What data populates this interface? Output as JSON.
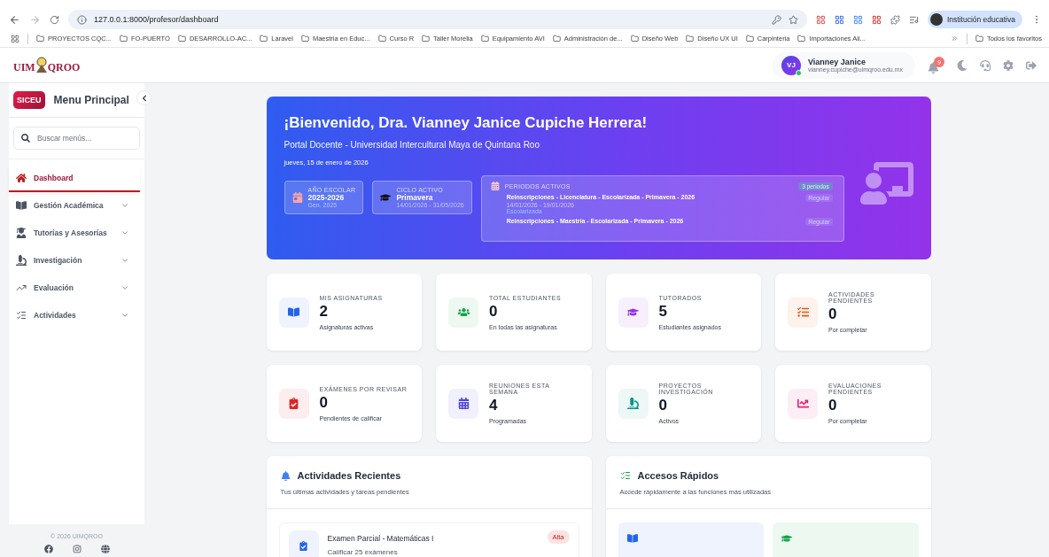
{
  "browser": {
    "url": "127.0.0.1:8000/profesor/dashboard",
    "profile": "Institución educativa",
    "bookmarks": [
      "PROYECTOS CQC...",
      "FO-PUERTO",
      "DESARROLLO-AC...",
      "Laravel",
      "Maestria en Educ...",
      "Curso R",
      "Taller Morelia",
      "Equipamiento AVI",
      "Administración de...",
      "Diseño Web",
      "Diseño UX UI",
      "Carpinteria",
      "Importaciones Ali..."
    ],
    "all_bookmarks": "Todos los favoritos"
  },
  "header": {
    "logo_left": "UIM",
    "logo_right": "QROO",
    "user": {
      "initials": "VJ",
      "name": "Vianney Janice",
      "email": "vianney.cupiche@uimqroo.edu.mx",
      "online": true
    },
    "notifications": "9"
  },
  "sidebar": {
    "badge": "SICEU",
    "title": "Menu Principal",
    "search": {
      "placeholder": "Buscar menús..."
    },
    "items": [
      {
        "label": "Dashboard",
        "selected": true,
        "expandable": false
      },
      {
        "label": "Gestión Académica",
        "selected": false,
        "expandable": true
      },
      {
        "label": "Tutorías y Asesorías",
        "selected": false,
        "expandable": true
      },
      {
        "label": "Investigación",
        "selected": false,
        "expandable": true
      },
      {
        "label": "Evaluación",
        "selected": false,
        "expandable": true
      },
      {
        "label": "Actividades",
        "selected": false,
        "expandable": true
      }
    ],
    "copyright": "© 2026 UIMQROO"
  },
  "hero": {
    "title": "¡Bienvenido, Dra. Vianney Janice Cupiche Herrera!",
    "subtitle": "Portal Docente - Universidad Intercultural Maya de Quintana Roo",
    "date": "jueves, 15 de enero de 2026",
    "info": [
      {
        "label": "AÑO ESCOLAR",
        "value": "2025-2026",
        "sub": "Gen. 2025"
      },
      {
        "label": "CICLO ACTIVO",
        "value": "Primavera",
        "sub": "14/01/2026 - 31/05/2026"
      }
    ],
    "periods": {
      "title": "PERIODOS ACTIVOS",
      "count": "3 periodos",
      "items": [
        {
          "name": "Reinscripciones - Licenciatura - Escolarizada - Primavera - 2026",
          "dates": "14/01/2026 - 19/01/2026",
          "mode": "Escolarizada",
          "type": "Regular"
        },
        {
          "name": "Reinscripciones - Maestría - Escolarizada - Primavera - 2026",
          "type": "Regular"
        }
      ]
    }
  },
  "stats": [
    {
      "label": "MIS ASIGNATURAS",
      "value": "2",
      "caption": "Asignaturas activas",
      "color": "#2563eb"
    },
    {
      "label": "TOTAL ESTUDIANTES",
      "value": "0",
      "caption": "En todas las asignaturas",
      "color": "#16a34a"
    },
    {
      "label": "TUTORADOS",
      "value": "5",
      "caption": "Estudiantes asignados",
      "color": "#9333ea"
    },
    {
      "label": "ACTIVIDADES PENDIENTES",
      "value": "0",
      "caption": "Por completar",
      "color": "#ea580c"
    },
    {
      "label": "EXÁMENES POR REVISAR",
      "value": "0",
      "caption": "Pendientes de calificar",
      "color": "#dc2626"
    },
    {
      "label": "REUNIONES ESTA SEMANA",
      "value": "4",
      "caption": "Programadas",
      "color": "#4f46e5"
    },
    {
      "label": "PROYECTOS INVESTIGACIÓN",
      "value": "0",
      "caption": "Activos",
      "color": "#0d9488"
    },
    {
      "label": "EVALUACIONES PENDIENTES",
      "value": "0",
      "caption": "Por completar",
      "color": "#db2777"
    }
  ],
  "recent": {
    "title": "Actividades Recientes",
    "subtitle": "Tus últimas actividades y tareas pendientes",
    "items": [
      {
        "title": "Examen Parcial - Matemáticas I",
        "detail": "Calificar 25 exámenes",
        "priority": "Alta"
      }
    ]
  },
  "quick": {
    "title": "Accesos Rápidos",
    "subtitle": "Accede rápidamente a las funciones más utilizadas",
    "items": [
      {
        "color": "#2563eb"
      },
      {
        "color": "#16a34a"
      }
    ]
  }
}
